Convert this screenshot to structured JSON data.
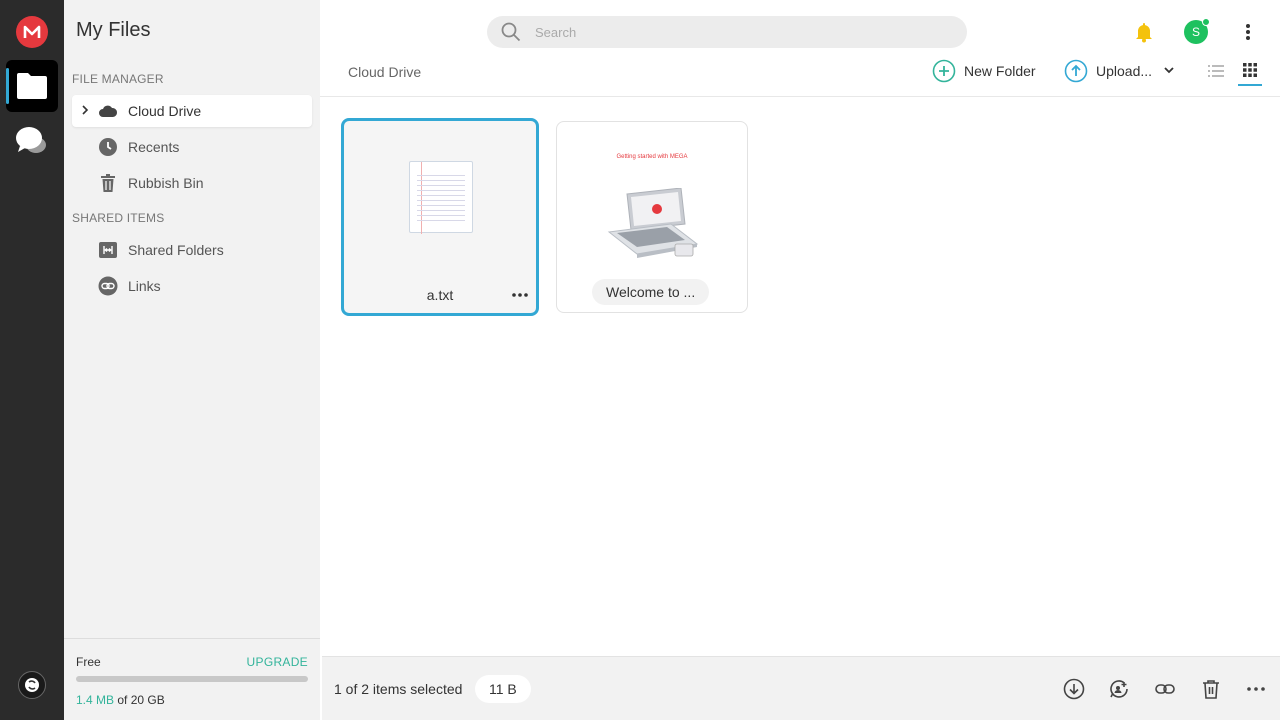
{
  "app": {
    "title": "My Files"
  },
  "sidebar": {
    "section_file_manager": "FILE MANAGER",
    "section_shared": "SHARED ITEMS",
    "items": [
      {
        "label": "Cloud Drive",
        "icon": "cloud-icon",
        "active": true
      },
      {
        "label": "Recents",
        "icon": "clock-icon"
      },
      {
        "label": "Rubbish Bin",
        "icon": "trash-icon"
      },
      {
        "label": "Shared Folders",
        "icon": "shared-folders-icon"
      },
      {
        "label": "Links",
        "icon": "link-icon"
      }
    ],
    "storage": {
      "plan": "Free",
      "upgrade": "UPGRADE",
      "used": "1.4 MB",
      "of_total": "of 20 GB"
    }
  },
  "search": {
    "placeholder": "Search"
  },
  "header": {
    "avatar_initial": "S"
  },
  "toolbar": {
    "breadcrumb": "Cloud Drive",
    "new_folder": "New Folder",
    "upload": "Upload..."
  },
  "files": [
    {
      "name": "a.txt",
      "selected": true
    },
    {
      "name": "Welcome to ...",
      "selected": false,
      "thumb_header": "Getting started with MEGA"
    }
  ],
  "footer": {
    "selection": "1 of 2 items selected",
    "size": "11 B"
  },
  "colors": {
    "accent": "#33a8d4",
    "brand": "#e5393e",
    "green": "#33b49b",
    "avatar": "#1ec15f"
  }
}
